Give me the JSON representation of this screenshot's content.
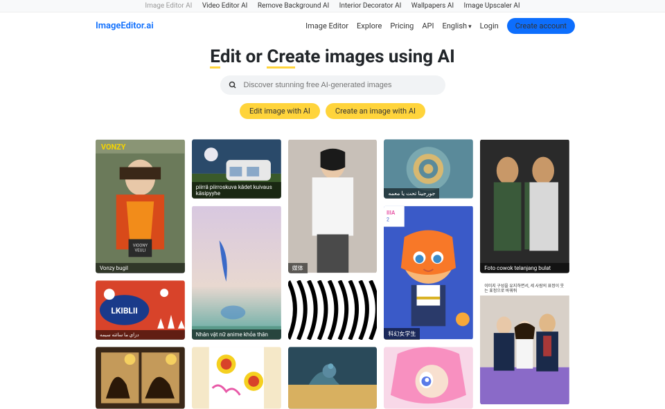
{
  "topbar": {
    "items": [
      {
        "label": "Image Editor AI",
        "active": true
      },
      {
        "label": "Video Editor AI"
      },
      {
        "label": "Remove Background AI"
      },
      {
        "label": "Interior Decorator AI"
      },
      {
        "label": "Wallpapers AI"
      },
      {
        "label": "Image Upscaler AI"
      }
    ]
  },
  "nav": {
    "logo": "ImageEditor.ai",
    "links": {
      "image_editor": "Image Editor",
      "explore": "Explore",
      "pricing": "Pricing",
      "api": "API",
      "lang": "English",
      "login": "Login",
      "create": "Create account"
    }
  },
  "hero": {
    "title_pre": "E",
    "title_mid1": "dit or ",
    "title_u2": "Cre",
    "title_post": "ate images using AI"
  },
  "search": {
    "placeholder": "Discover stunning free AI-generated images"
  },
  "pills": {
    "edit": "Edit image with AI",
    "create": "Create an image with AI"
  },
  "cards": {
    "c1": "Vonzy bugil",
    "c2": "piirrä piirroskuva kädet kuivaus käsipyyhe",
    "c3": "Nhân vật nữ anime khỏa thân",
    "c4": "媒体",
    "c5": "جورجينا تحت يا معمه",
    "c6": "科幻女学生",
    "c7": "Foto cowok telanjang bulat",
    "c8": "이미지 구성을 유지하면서, 세 사람의 표정이 웃는 표정으로 바꿔줘"
  }
}
